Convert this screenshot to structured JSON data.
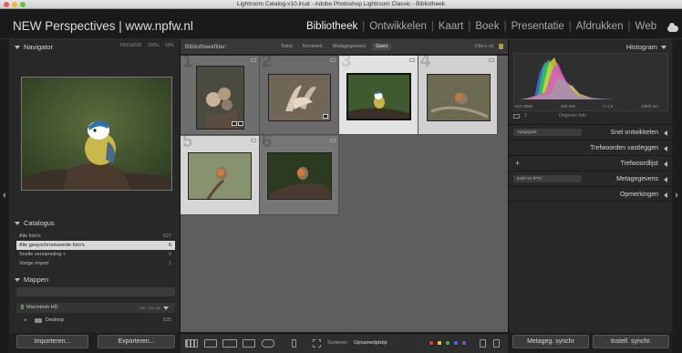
{
  "window": {
    "title": "Lightroom Catalog-v10.lrcat - Adobe Photoshop Lightroom Classic - Bibliotheek"
  },
  "identity_plate": "NEW Perspectives | www.npfw.nl",
  "modules": [
    "Bibliotheek",
    "Ontwikkelen",
    "Kaart",
    "Boek",
    "Presentatie",
    "Afdrukken",
    "Web"
  ],
  "active_module": "Bibliotheek",
  "navigator": {
    "title": "Navigator",
    "options": [
      "PASSEND",
      "100%",
      "50%"
    ]
  },
  "catalog": {
    "title": "Catalogus",
    "items": [
      {
        "label": "Alle foto's",
        "count": "527"
      },
      {
        "label": "Alle gesynchroniseerde foto's",
        "count": "6"
      },
      {
        "label": "Snelle verzameling +",
        "count": "0"
      },
      {
        "label": "Vorige import",
        "count": "1"
      }
    ]
  },
  "folders": {
    "title": "Mappen",
    "add": "+",
    "volume": {
      "name": "Macintosh HD",
      "space": "188 / 500 GB"
    },
    "items": [
      {
        "label": "Desktop",
        "count": "525"
      }
    ]
  },
  "buttons": {
    "import": "Importeren...",
    "export": "Exporteren...",
    "sync_metadata": "Metageg. synchr",
    "sync_settings": "Instell. synchr."
  },
  "filter": {
    "label": "Bibliotheekfilter:",
    "tabs": [
      "Tekst",
      "Kenmerk",
      "Metagegevens",
      "Geen"
    ],
    "active_tab": "Geen",
    "preset": "Filters uit"
  },
  "grid": {
    "cell_numbers": [
      "1",
      "2",
      "3",
      "4",
      "5",
      "6"
    ],
    "selected_index": 2
  },
  "toolbar": {
    "sort_label": "Sorteren:",
    "sort_value": "Opnametijdstip"
  },
  "color_labels": [
    "#d63b3b",
    "#e3c23a",
    "#4da34a",
    "#3c6fd1",
    "#8e4fb9"
  ],
  "histogram": {
    "title": "Histogram",
    "info": [
      "ISO 3000",
      "300 mm",
      "f / 4,0",
      "1/500 sec"
    ],
    "original_label": "Originele foto"
  },
  "right_panels": [
    {
      "label": "Snel ontwikkelen",
      "dropdown": "Aangepast"
    },
    {
      "label": "Trefwoorden vastleggen"
    },
    {
      "label": "Trefwoordlijst",
      "plus": "+"
    },
    {
      "label": "Metagegevens",
      "dropdown": "EXIF en IPTC"
    },
    {
      "label": "Opmerkingen"
    }
  ]
}
